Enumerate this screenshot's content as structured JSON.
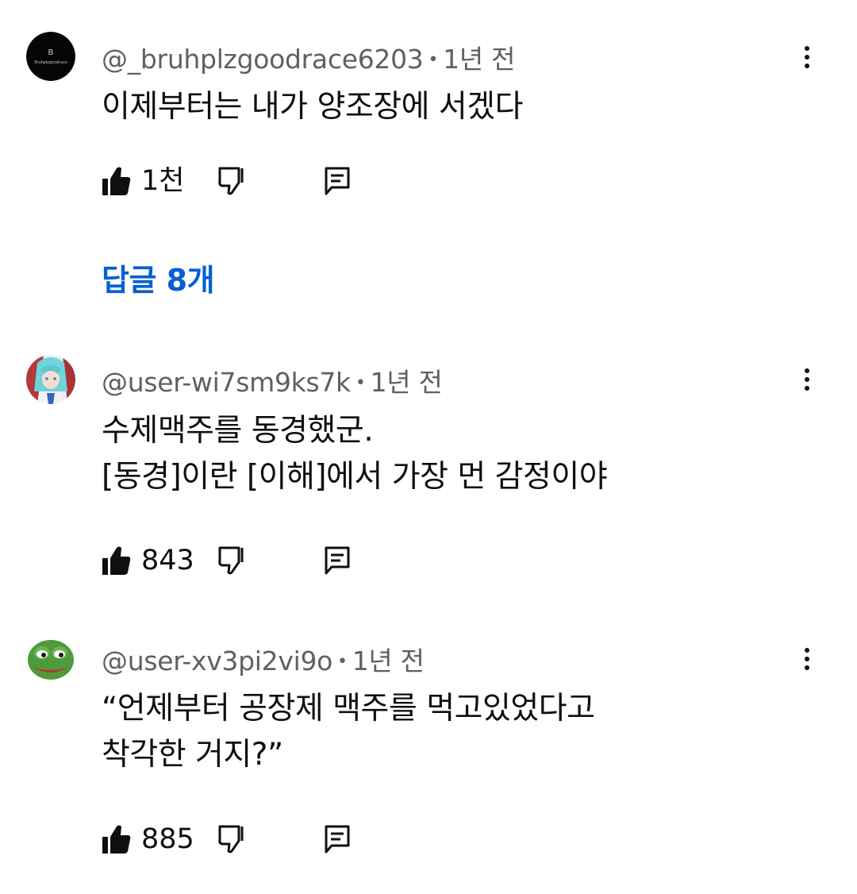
{
  "comments": [
    {
      "author": "@_bruhplzgoodrace6203",
      "time": "1년 전",
      "lines": [
        "이제부터는 내가 양조장에 서겠다"
      ],
      "likes": "1천",
      "replies_label": "답글 8개",
      "avatar_text": "B",
      "avatar_subtext": "Bruhplzgoodrace"
    },
    {
      "author": "@user-wi7sm9ks7k",
      "time": "1년 전",
      "lines": [
        "수제맥주를 동경했군.",
        "[동경]이란 [이해]에서 가장 먼 감정이야"
      ],
      "likes": "843"
    },
    {
      "author": "@user-xv3pi2vi9o",
      "time": "1년 전",
      "lines": [
        "“언제부터 공장제 맥주를 먹고있었다고",
        "착각한 거지?”"
      ],
      "likes": "885"
    }
  ],
  "icons": {
    "like": "thumbs-up-icon",
    "dislike": "thumbs-down-icon",
    "reply": "reply-icon",
    "more": "more-vert-icon"
  },
  "colors": {
    "link_blue": "#065fd4",
    "meta_gray": "#606060",
    "text": "#0f0f0f"
  }
}
